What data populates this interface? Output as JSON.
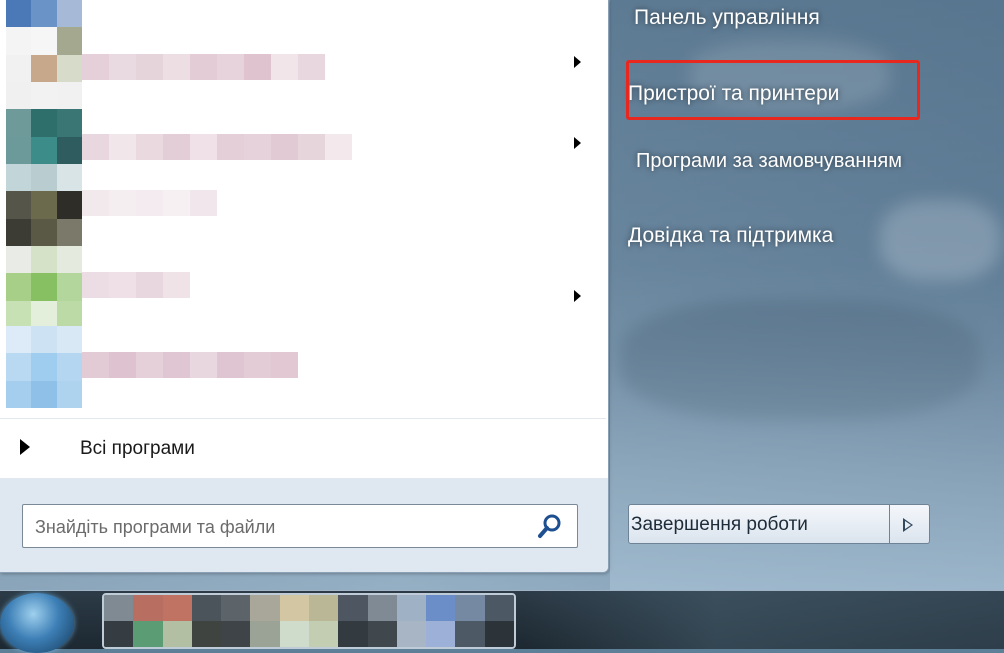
{
  "start_menu": {
    "all_programs_label": "Всі програми",
    "search": {
      "placeholder": "Знайдіть програми та файли"
    },
    "right_items": [
      {
        "label": "Панель управління"
      },
      {
        "label": "Пристрої та принтери"
      },
      {
        "label": "Програми за замовчуванням"
      },
      {
        "label": "Довідка та підтримка"
      }
    ],
    "shutdown_label": "Завершення роботи"
  },
  "colors": {
    "highlight": "#e8281e",
    "search_bg": "#dfe8f1"
  }
}
